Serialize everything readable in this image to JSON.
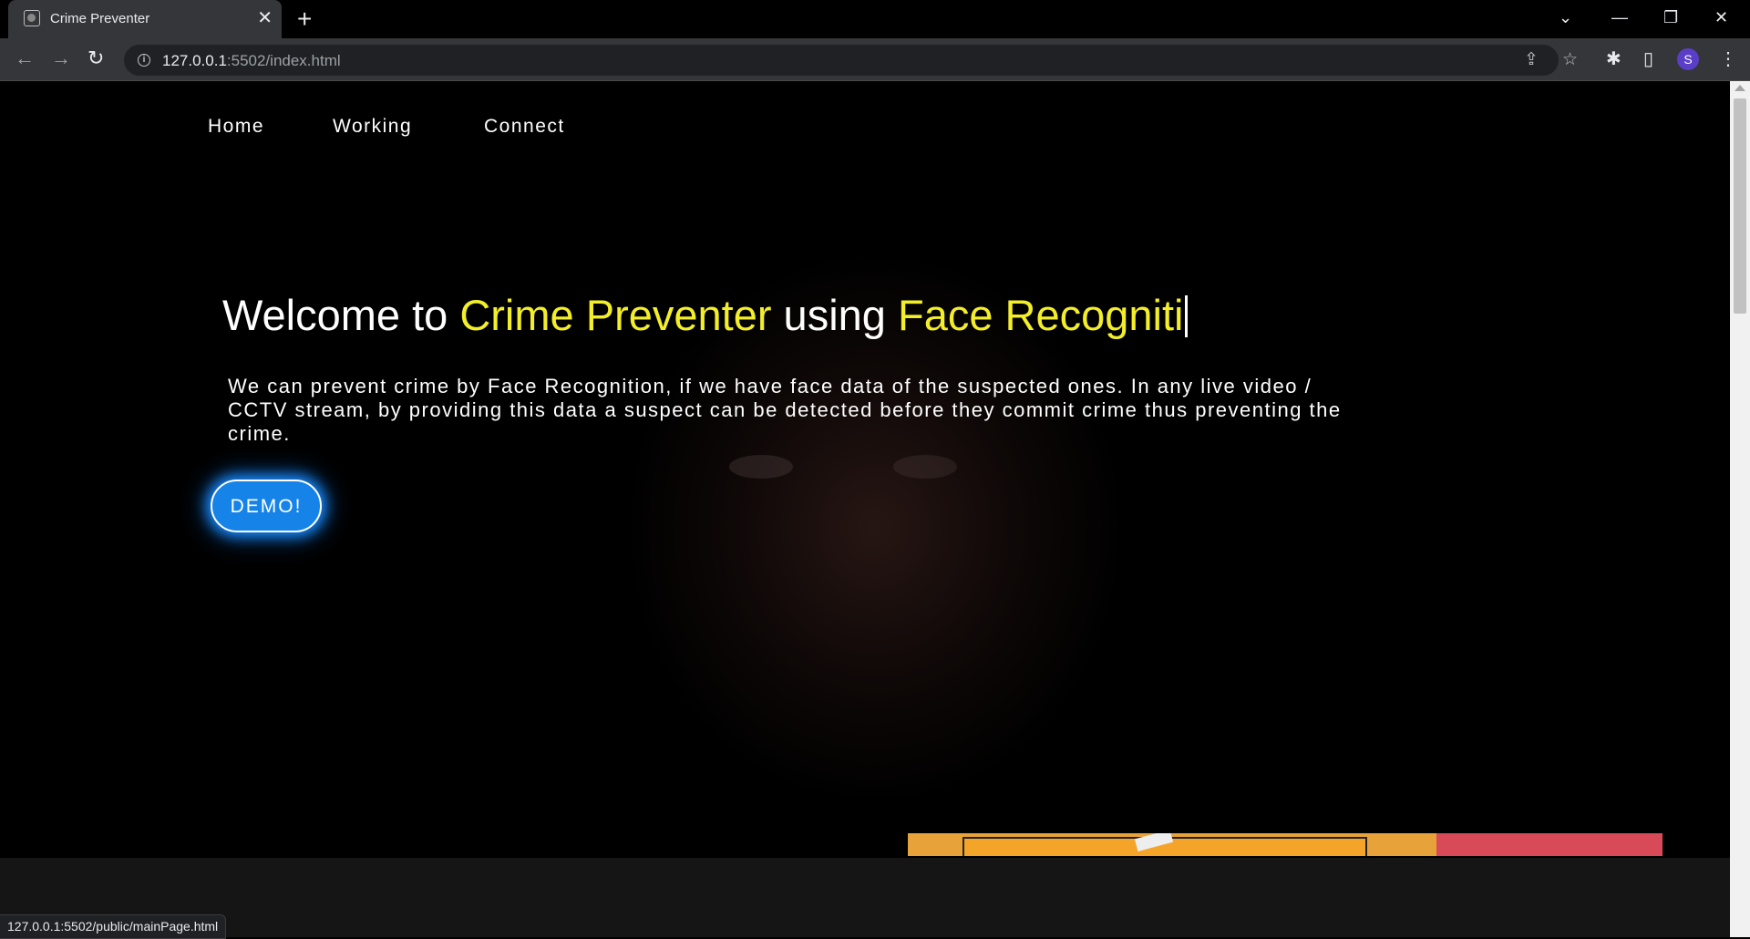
{
  "browser": {
    "tab_title": "Crime Preventer",
    "tab_close": "✕",
    "new_tab": "+",
    "window_controls": {
      "tab_search": "⌄",
      "minimize": "—",
      "restore": "❐",
      "close": "✕"
    },
    "nav": {
      "back": "←",
      "forward": "→",
      "reload": "↻"
    },
    "url_host": "127.0.0.1",
    "url_rest": ":5502/index.html",
    "icons": {
      "site_info": "info-icon",
      "share": "share-icon",
      "bookmark": "star-icon",
      "extensions": "puzzle-icon",
      "side_panel": "side-panel-icon",
      "menu": "kebab-menu-icon"
    },
    "share_glyph": "⇪",
    "star_glyph": "☆",
    "extensions_glyph": "✱",
    "side_panel_glyph": "▯",
    "menu_glyph": "⋮",
    "profile_initial": "S",
    "status_url": "127.0.0.1:5502/public/mainPage.html"
  },
  "page": {
    "nav_links": [
      "Home",
      "Working",
      "Connect"
    ],
    "headline": {
      "part1": "Welcome to ",
      "highlight1": "Crime Preventer",
      "part2": " using ",
      "highlight2": "Face Recogniti"
    },
    "description": "We can prevent crime by Face Recognition, if we have face data of the suspected ones. In any live video / CCTV stream, by providing this data a suspect can be detected before they commit crime thus preventing the crime.",
    "demo_button": "DEMO!"
  },
  "colors": {
    "highlight": "#f3ee2a",
    "button": "#1583e8",
    "button_glow": "#1a8cff",
    "hero_bg": "#000000",
    "section_bg": "#151515"
  }
}
